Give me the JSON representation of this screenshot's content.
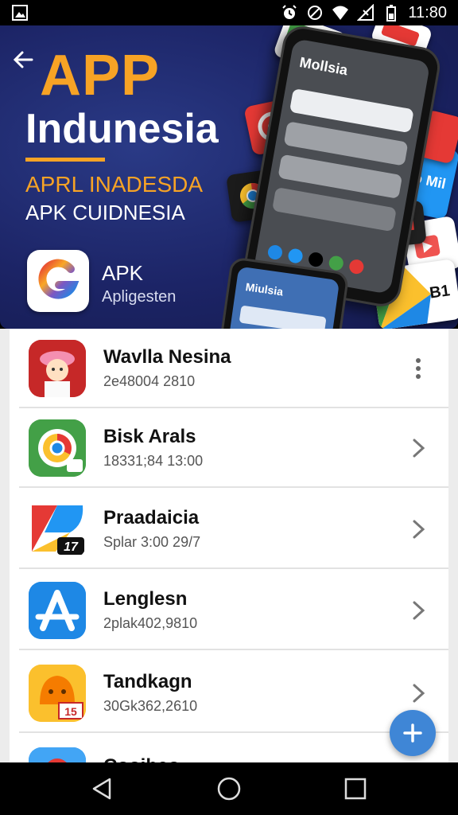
{
  "status_bar": {
    "time": "11:80",
    "icons": [
      "image-icon",
      "alarm-icon",
      "do-not-disturb-icon",
      "wifi-icon",
      "no-signal-icon",
      "battery-icon"
    ]
  },
  "hero": {
    "title": "APP",
    "subtitle": "Indunesia",
    "line1": "APRL INADESDA",
    "line2": "APK CUIDNESIA",
    "app_name": "APK",
    "app_sub": "Apligesten",
    "phone_title": "Mollsia",
    "phone2_title": "Miulsia",
    "card_text_1": "Go Mil",
    "card_text_2": "B1",
    "accent": "#f7a325",
    "background": "#1c2466"
  },
  "list": {
    "items": [
      {
        "title": "Wavlla Nesina",
        "subtitle": "2e48004 2810",
        "action": "more-vert-icon",
        "icon": "character-icon"
      },
      {
        "title": "Bisk Arals",
        "subtitle": "18331;84 13:00",
        "action": "chevron-right-icon",
        "icon": "chrome-like-icon"
      },
      {
        "title": "Praadaicia",
        "subtitle": "Splar 3:00 29/7",
        "action": "chevron-right-icon",
        "icon": "play-like-icon",
        "badge": "17"
      },
      {
        "title": "Lenglesn",
        "subtitle": "2plak402,9810",
        "action": "chevron-right-icon",
        "icon": "app-store-icon"
      },
      {
        "title": "Tandkagn",
        "subtitle": "30Gk362,2610",
        "action": "chevron-right-icon",
        "icon": "orange-mascot-icon",
        "badge": "15"
      },
      {
        "title": "Cooiheo",
        "subtitle": "",
        "action": "chevron-right-icon",
        "icon": "partial-icon"
      }
    ]
  },
  "fab": {
    "label": "+"
  },
  "nav": {
    "buttons": [
      "back-icon",
      "home-icon",
      "recents-icon"
    ]
  }
}
